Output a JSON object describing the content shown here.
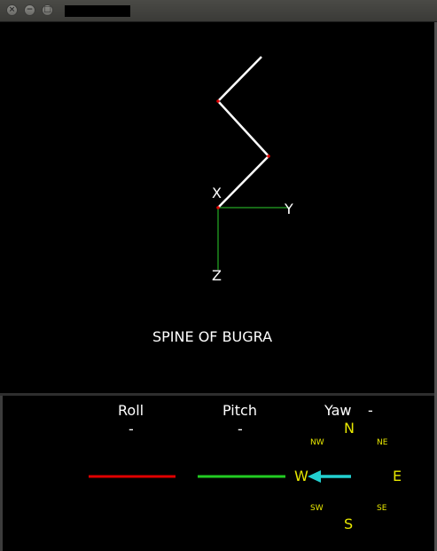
{
  "window": {
    "close_glyph": "×",
    "minimize_glyph": "−",
    "maximize_glyph": "□"
  },
  "scene": {
    "title": "SPINE OF BUGRA",
    "axis_x": "X",
    "axis_y": "Y",
    "axis_z": "Z",
    "colors": {
      "spine": "#ffffff",
      "joint": "#e00000",
      "axis": "#1e8a1e"
    }
  },
  "orientation": {
    "roll_label": "Roll",
    "roll_value": "-",
    "pitch_label": "Pitch",
    "pitch_value": "-",
    "yaw_label": "Yaw",
    "yaw_value": "-",
    "colors": {
      "roll_bar": "#e00000",
      "pitch_bar": "#22cc22",
      "yaw_arrow": "#22d0d0",
      "compass_text": "#e8e800"
    }
  },
  "compass": {
    "n": "N",
    "s": "S",
    "e": "E",
    "w": "W",
    "ne": "NE",
    "nw": "NW",
    "se": "SE",
    "sw": "SW"
  }
}
